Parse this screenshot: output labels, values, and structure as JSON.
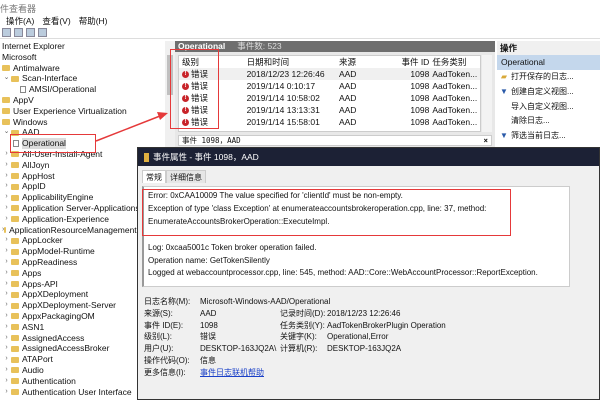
{
  "window": {
    "title": "件查看器"
  },
  "menu": [
    "操作(A)",
    "查看(V)",
    "帮助(H)"
  ],
  "tree": [
    {
      "label": "Internet Explorer",
      "indent": 0,
      "type": "text"
    },
    {
      "label": "Microsoft",
      "indent": 0,
      "type": "text"
    },
    {
      "label": "Antimalware",
      "indent": 0,
      "type": "folder"
    },
    {
      "label": "Scan-Interface",
      "indent": 1,
      "type": "folder",
      "expanded": true
    },
    {
      "label": "AMSI/Operational",
      "indent": 2,
      "type": "log"
    },
    {
      "label": "AppV",
      "indent": 0,
      "type": "folder"
    },
    {
      "label": "User Experience Virtualization",
      "indent": 0,
      "type": "folder"
    },
    {
      "label": "Windows",
      "indent": 0,
      "type": "folder"
    },
    {
      "label": "AAD",
      "indent": 1,
      "type": "folder",
      "expanded": true
    },
    {
      "label": "Operational",
      "indent": 2,
      "type": "log",
      "selected": true
    },
    {
      "label": "All-User-Install-Agent",
      "indent": 1,
      "type": "folder",
      "collapsed": true
    },
    {
      "label": "AllJoyn",
      "indent": 1,
      "type": "folder",
      "collapsed": true
    },
    {
      "label": "AppHost",
      "indent": 1,
      "type": "folder",
      "collapsed": true
    },
    {
      "label": "AppID",
      "indent": 1,
      "type": "folder",
      "collapsed": true
    },
    {
      "label": "ApplicabilityEngine",
      "indent": 1,
      "type": "folder",
      "collapsed": true
    },
    {
      "label": "Application Server-Applications",
      "indent": 1,
      "type": "folder",
      "collapsed": true
    },
    {
      "label": "Application-Experience",
      "indent": 1,
      "type": "folder",
      "collapsed": true
    },
    {
      "label": "ApplicationResourceManagementSystem",
      "indent": 1,
      "type": "folder",
      "collapsed": true
    },
    {
      "label": "AppLocker",
      "indent": 1,
      "type": "folder",
      "collapsed": true
    },
    {
      "label": "AppModel-Runtime",
      "indent": 1,
      "type": "folder",
      "collapsed": true
    },
    {
      "label": "AppReadiness",
      "indent": 1,
      "type": "folder",
      "collapsed": true
    },
    {
      "label": "Apps",
      "indent": 1,
      "type": "folder",
      "collapsed": true
    },
    {
      "label": "Apps-API",
      "indent": 1,
      "type": "folder",
      "collapsed": true
    },
    {
      "label": "AppXDeployment",
      "indent": 1,
      "type": "folder",
      "collapsed": true
    },
    {
      "label": "AppXDeployment-Server",
      "indent": 1,
      "type": "folder",
      "collapsed": true
    },
    {
      "label": "AppxPackagingOM",
      "indent": 1,
      "type": "folder",
      "collapsed": true
    },
    {
      "label": "ASN1",
      "indent": 1,
      "type": "folder",
      "collapsed": true
    },
    {
      "label": "AssignedAccess",
      "indent": 1,
      "type": "folder",
      "collapsed": true
    },
    {
      "label": "AssignedAccessBroker",
      "indent": 1,
      "type": "folder",
      "collapsed": true
    },
    {
      "label": "ATAPort",
      "indent": 1,
      "type": "folder",
      "collapsed": true
    },
    {
      "label": "Audio",
      "indent": 1,
      "type": "folder",
      "collapsed": true
    },
    {
      "label": "Authentication",
      "indent": 1,
      "type": "folder",
      "collapsed": true
    },
    {
      "label": "Authentication User Interface",
      "indent": 1,
      "type": "folder",
      "collapsed": true
    }
  ],
  "center": {
    "title": "Operational",
    "count_label": "事件数: 523",
    "columns": [
      "级别",
      "日期和时间",
      "来源",
      "事件 ID",
      "任务类别"
    ],
    "rows": [
      [
        "错误",
        "2018/12/23 12:26:46",
        "AAD",
        "1098",
        "AadToken..."
      ],
      [
        "错误",
        "2019/1/14 0:10:17",
        "AAD",
        "1098",
        "AadToken..."
      ],
      [
        "错误",
        "2019/1/14 10:58:02",
        "AAD",
        "1098",
        "AadToken..."
      ],
      [
        "错误",
        "2019/1/14 13:13:31",
        "AAD",
        "1098",
        "AadToken..."
      ],
      [
        "错误",
        "2019/1/14 15:58:01",
        "AAD",
        "1098",
        "AadToken..."
      ]
    ],
    "event_strip": "事件 1098，AAD",
    "close": "×"
  },
  "actions": {
    "header": "操作",
    "selected": "Operational",
    "items": [
      {
        "label": "打开保存的日志...",
        "icon": "folder-open-icon"
      },
      {
        "label": "创建自定义视图...",
        "icon": "filter-icon"
      },
      {
        "label": "导入自定义视图...",
        "icon": ""
      },
      {
        "label": "清除日志...",
        "icon": ""
      },
      {
        "label": "筛选当前日志...",
        "icon": "filter-icon"
      }
    ]
  },
  "dialog": {
    "title": "事件属性 - 事件 1098，AAD",
    "tabs": [
      "常规",
      "详细信息"
    ],
    "message": [
      "Error: 0xCAA10009 The value specified for 'clientId' must be non-empty.",
      "Exception of type 'class Exception' at enumerateaccountsbrokeroperation.cpp, line: 37, method:",
      "EnumerateAccountsBrokerOperation::ExecuteImpl.",
      "",
      "Log: 0xcaa5001c Token broker operation failed.",
      "Operation name: GetTokenSilently",
      "Logged at webaccountprocessor.cpp, line: 545, method: AAD::Core::WebAccountProcessor::ReportException."
    ],
    "log_name_label": "日志名称(M):",
    "log_name": "Microsoft-Windows-AAD/Operational",
    "props": [
      [
        "来源(S):",
        "AAD",
        "记录时间(D):",
        "2018/12/23 12:26:46"
      ],
      [
        "事件 ID(E):",
        "1098",
        "任务类别(Y):",
        "AadTokenBrokerPlugin Operation"
      ],
      [
        "级别(L):",
        "错误",
        "关键字(K):",
        "Operational,Error"
      ],
      [
        "用户(U):",
        "DESKTOP-163JQ2A\\",
        "计算机(R):",
        "DESKTOP-163JQ2A"
      ],
      [
        "操作代码(O):",
        "信息",
        "",
        ""
      ]
    ],
    "more_info_label": "更多信息(I):",
    "more_info_link": "事件日志联机帮助"
  },
  "colors": {
    "annotation": "#e5393a",
    "title_dark": "#1c2135",
    "error": "#c8242a",
    "selection": "#c4d7ec"
  }
}
